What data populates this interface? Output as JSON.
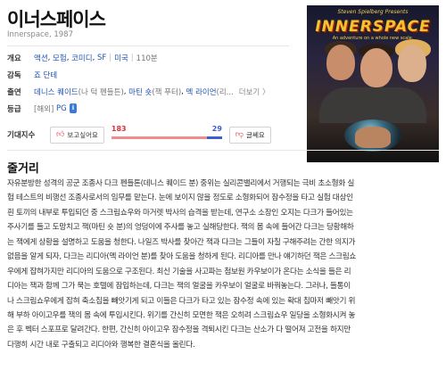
{
  "title": "이너스페이스",
  "subtitle": "Innerspace, 1987",
  "info": {
    "overview": {
      "label": "개요",
      "genres": [
        "액션",
        "모험",
        "코미디",
        "SF"
      ],
      "country": "미국",
      "runtime": "110분"
    },
    "director": {
      "label": "감독",
      "name": "죠 단테"
    },
    "cast": {
      "label": "출연",
      "a1_name": "데니스 퀘이드",
      "a1_role": "(나 턱 펜들튼)",
      "a2_name": "마틴 숏",
      "a2_role": "(잭 푸터)",
      "a3_name": "멕 라이언",
      "a3_role": "(리...",
      "more": "더보기 〉"
    },
    "rating": {
      "label": "등급",
      "source": "[해외]",
      "value": "PG",
      "badge": "i"
    }
  },
  "opinion": {
    "label": "기대지수",
    "like_label": "보고싶어요",
    "like_count": "183",
    "dislike_count": "29",
    "dislike_label": "글쎄요",
    "like_ratio": 0.863
  },
  "poster": {
    "presenter": "Steven Spielberg Presents",
    "logo": "INNERSPACE",
    "tagline": "An adventure on a whole new scale."
  },
  "plot": {
    "heading": "줄거리",
    "lines": [
      "자유분방한 성격의 공군 조종사 다크 펜들톤(데니스 퀘이드 분) 중위는 실리콘밸리에서 거행되는 극비 초소형화 실",
      "험 테스트의 비행선 조종사로서의 임무를 맡는다. 눈에 보이지 않을 정도로 소형화되어 잠수정을 타고 실험 대상인",
      "흰 토끼의 내부로 투입되던 중 스크림쇼우와 마거렛 박사의 습격을 받는데, 연구소 소장인 오지는 다크가 들어있는",
      "주사기를 들고 도망치고 잭(마틴 숏 분)의 엉덩이에 주사를 놓고 실해당한다. 잭의 몸 속에 들어간 다크는 당황해하",
      "는 잭에게 상황을 설명하고 도움을 청한다. 나일즈 박사를 찾아간 잭과 다크는 그들이 자칠 구해주려는 간한 의지가",
      "없음을 알게 되자, 다크는 리디아(멕 라이언 분)를 찾아 도움을 청하게 된다. 리디아를 만나 얘기하던 잭은 스크림쇼",
      "우에게 잡혀가지만 리디아의 도움으로 구조된다. 최신 기술을 사고파는 첨보원 카우보이가 온다는 소식을 들은 리",
      "디아는 잭과 함께 그가 묵는 호텔에 잠입하는데, 다크는 잭의 얼굴을 카우보이 얼굴로 바꿔놓는다. 그러나, 들통이",
      "나 스크림쇼우에게 잡혀 축소칩을 빼앗기게 되고 이들은 다크가 타고 있는 잠수정 속에 있는 확대 칩마저 빼앗기 위",
      "해 부하 아이고우를 잭의 몸 속에 투입시킨다. 위기를 간신히 모면한 잭은 오히려 스크림쇼우 일당을 소형화시켜 놓",
      "은 후 벡터 스포프로 달려간다. 한편, 간신히 아이고우 잠수정을 격퇴시킨 다크는 산소가 다 떨어져 고전을 하지만",
      "다행히 시간 내로 구출되고 리디아와 행복한 결혼식을 올린다."
    ]
  }
}
